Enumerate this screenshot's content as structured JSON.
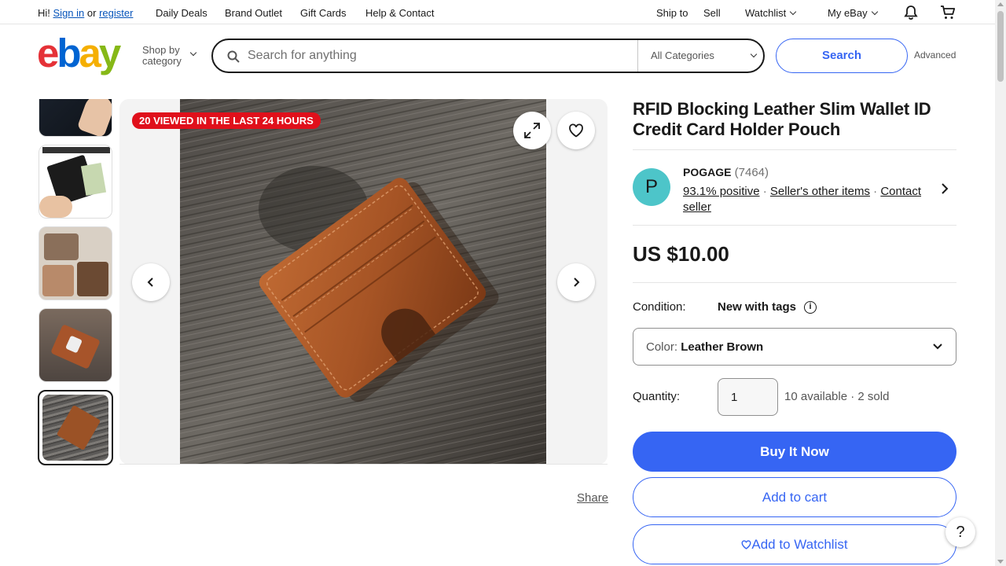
{
  "topbar": {
    "greeting": "Hi!",
    "sign_in": "Sign in",
    "or": "or",
    "register": "register",
    "nav": [
      "Daily Deals",
      "Brand Outlet",
      "Gift Cards",
      "Help & Contact"
    ],
    "ship_to": "Ship to",
    "sell": "Sell",
    "watchlist": "Watchlist",
    "my_ebay": "My eBay"
  },
  "header": {
    "logo": {
      "e": "e",
      "b": "b",
      "a": "a",
      "y": "y"
    },
    "logo_colors": {
      "e": "#e53238",
      "b": "#0064d2",
      "a": "#f5af02",
      "y": "#86b817"
    },
    "shop_by_line1": "Shop by",
    "shop_by_line2": "category",
    "search_placeholder": "Search for anything",
    "category_select": "All Categories",
    "search_button": "Search",
    "advanced": "Advanced"
  },
  "gallery": {
    "badge": "20 VIEWED IN THE LAST 24 HOURS",
    "share": "Share",
    "thumbnails": [
      "thumb-1",
      "thumb-2",
      "thumb-3",
      "thumb-4",
      "thumb-5"
    ],
    "selected_index": 4
  },
  "item": {
    "title": "RFID Blocking Leather Slim Wallet ID Credit Card Holder Pouch",
    "seller": {
      "avatar_letter": "P",
      "name": "POGAGE",
      "feedback": "(7464)",
      "positive": "93.1% positive",
      "sep": "·",
      "other_items": "Seller's other items",
      "contact": "Contact seller"
    },
    "price": "US $10.00",
    "condition_label": "Condition:",
    "condition_value": "New with tags",
    "color_label": "Color:",
    "color_value": "Leather Brown",
    "quantity_label": "Quantity:",
    "quantity_value": "1",
    "availability": "10 available · 2 sold",
    "buy_now": "Buy It Now",
    "add_to_cart": "Add to cart",
    "add_to_watchlist": "Add to Watchlist"
  },
  "help": "?",
  "colors": {
    "accent": "#3665f3",
    "badge": "#e0101b",
    "avatar": "#4dc5c9"
  }
}
